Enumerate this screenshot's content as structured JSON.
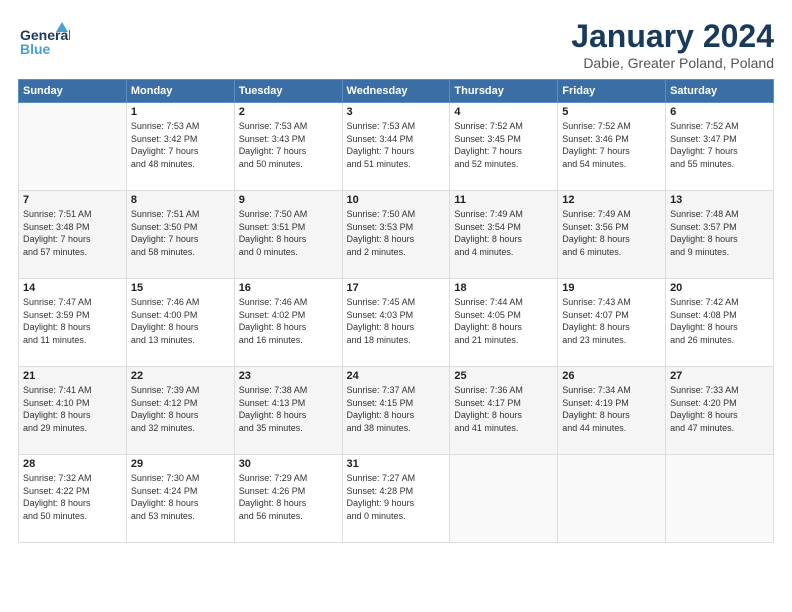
{
  "header": {
    "logo_line1": "General",
    "logo_line2": "Blue",
    "main_title": "January 2024",
    "subtitle": "Dabie, Greater Poland, Poland"
  },
  "weekdays": [
    "Sunday",
    "Monday",
    "Tuesday",
    "Wednesday",
    "Thursday",
    "Friday",
    "Saturday"
  ],
  "weeks": [
    [
      {
        "day": "",
        "info": ""
      },
      {
        "day": "1",
        "info": "Sunrise: 7:53 AM\nSunset: 3:42 PM\nDaylight: 7 hours\nand 48 minutes."
      },
      {
        "day": "2",
        "info": "Sunrise: 7:53 AM\nSunset: 3:43 PM\nDaylight: 7 hours\nand 50 minutes."
      },
      {
        "day": "3",
        "info": "Sunrise: 7:53 AM\nSunset: 3:44 PM\nDaylight: 7 hours\nand 51 minutes."
      },
      {
        "day": "4",
        "info": "Sunrise: 7:52 AM\nSunset: 3:45 PM\nDaylight: 7 hours\nand 52 minutes."
      },
      {
        "day": "5",
        "info": "Sunrise: 7:52 AM\nSunset: 3:46 PM\nDaylight: 7 hours\nand 54 minutes."
      },
      {
        "day": "6",
        "info": "Sunrise: 7:52 AM\nSunset: 3:47 PM\nDaylight: 7 hours\nand 55 minutes."
      }
    ],
    [
      {
        "day": "7",
        "info": "Sunrise: 7:51 AM\nSunset: 3:48 PM\nDaylight: 7 hours\nand 57 minutes."
      },
      {
        "day": "8",
        "info": "Sunrise: 7:51 AM\nSunset: 3:50 PM\nDaylight: 7 hours\nand 58 minutes."
      },
      {
        "day": "9",
        "info": "Sunrise: 7:50 AM\nSunset: 3:51 PM\nDaylight: 8 hours\nand 0 minutes."
      },
      {
        "day": "10",
        "info": "Sunrise: 7:50 AM\nSunset: 3:53 PM\nDaylight: 8 hours\nand 2 minutes."
      },
      {
        "day": "11",
        "info": "Sunrise: 7:49 AM\nSunset: 3:54 PM\nDaylight: 8 hours\nand 4 minutes."
      },
      {
        "day": "12",
        "info": "Sunrise: 7:49 AM\nSunset: 3:56 PM\nDaylight: 8 hours\nand 6 minutes."
      },
      {
        "day": "13",
        "info": "Sunrise: 7:48 AM\nSunset: 3:57 PM\nDaylight: 8 hours\nand 9 minutes."
      }
    ],
    [
      {
        "day": "14",
        "info": "Sunrise: 7:47 AM\nSunset: 3:59 PM\nDaylight: 8 hours\nand 11 minutes."
      },
      {
        "day": "15",
        "info": "Sunrise: 7:46 AM\nSunset: 4:00 PM\nDaylight: 8 hours\nand 13 minutes."
      },
      {
        "day": "16",
        "info": "Sunrise: 7:46 AM\nSunset: 4:02 PM\nDaylight: 8 hours\nand 16 minutes."
      },
      {
        "day": "17",
        "info": "Sunrise: 7:45 AM\nSunset: 4:03 PM\nDaylight: 8 hours\nand 18 minutes."
      },
      {
        "day": "18",
        "info": "Sunrise: 7:44 AM\nSunset: 4:05 PM\nDaylight: 8 hours\nand 21 minutes."
      },
      {
        "day": "19",
        "info": "Sunrise: 7:43 AM\nSunset: 4:07 PM\nDaylight: 8 hours\nand 23 minutes."
      },
      {
        "day": "20",
        "info": "Sunrise: 7:42 AM\nSunset: 4:08 PM\nDaylight: 8 hours\nand 26 minutes."
      }
    ],
    [
      {
        "day": "21",
        "info": "Sunrise: 7:41 AM\nSunset: 4:10 PM\nDaylight: 8 hours\nand 29 minutes."
      },
      {
        "day": "22",
        "info": "Sunrise: 7:39 AM\nSunset: 4:12 PM\nDaylight: 8 hours\nand 32 minutes."
      },
      {
        "day": "23",
        "info": "Sunrise: 7:38 AM\nSunset: 4:13 PM\nDaylight: 8 hours\nand 35 minutes."
      },
      {
        "day": "24",
        "info": "Sunrise: 7:37 AM\nSunset: 4:15 PM\nDaylight: 8 hours\nand 38 minutes."
      },
      {
        "day": "25",
        "info": "Sunrise: 7:36 AM\nSunset: 4:17 PM\nDaylight: 8 hours\nand 41 minutes."
      },
      {
        "day": "26",
        "info": "Sunrise: 7:34 AM\nSunset: 4:19 PM\nDaylight: 8 hours\nand 44 minutes."
      },
      {
        "day": "27",
        "info": "Sunrise: 7:33 AM\nSunset: 4:20 PM\nDaylight: 8 hours\nand 47 minutes."
      }
    ],
    [
      {
        "day": "28",
        "info": "Sunrise: 7:32 AM\nSunset: 4:22 PM\nDaylight: 8 hours\nand 50 minutes."
      },
      {
        "day": "29",
        "info": "Sunrise: 7:30 AM\nSunset: 4:24 PM\nDaylight: 8 hours\nand 53 minutes."
      },
      {
        "day": "30",
        "info": "Sunrise: 7:29 AM\nSunset: 4:26 PM\nDaylight: 8 hours\nand 56 minutes."
      },
      {
        "day": "31",
        "info": "Sunrise: 7:27 AM\nSunset: 4:28 PM\nDaylight: 9 hours\nand 0 minutes."
      },
      {
        "day": "",
        "info": ""
      },
      {
        "day": "",
        "info": ""
      },
      {
        "day": "",
        "info": ""
      }
    ]
  ]
}
